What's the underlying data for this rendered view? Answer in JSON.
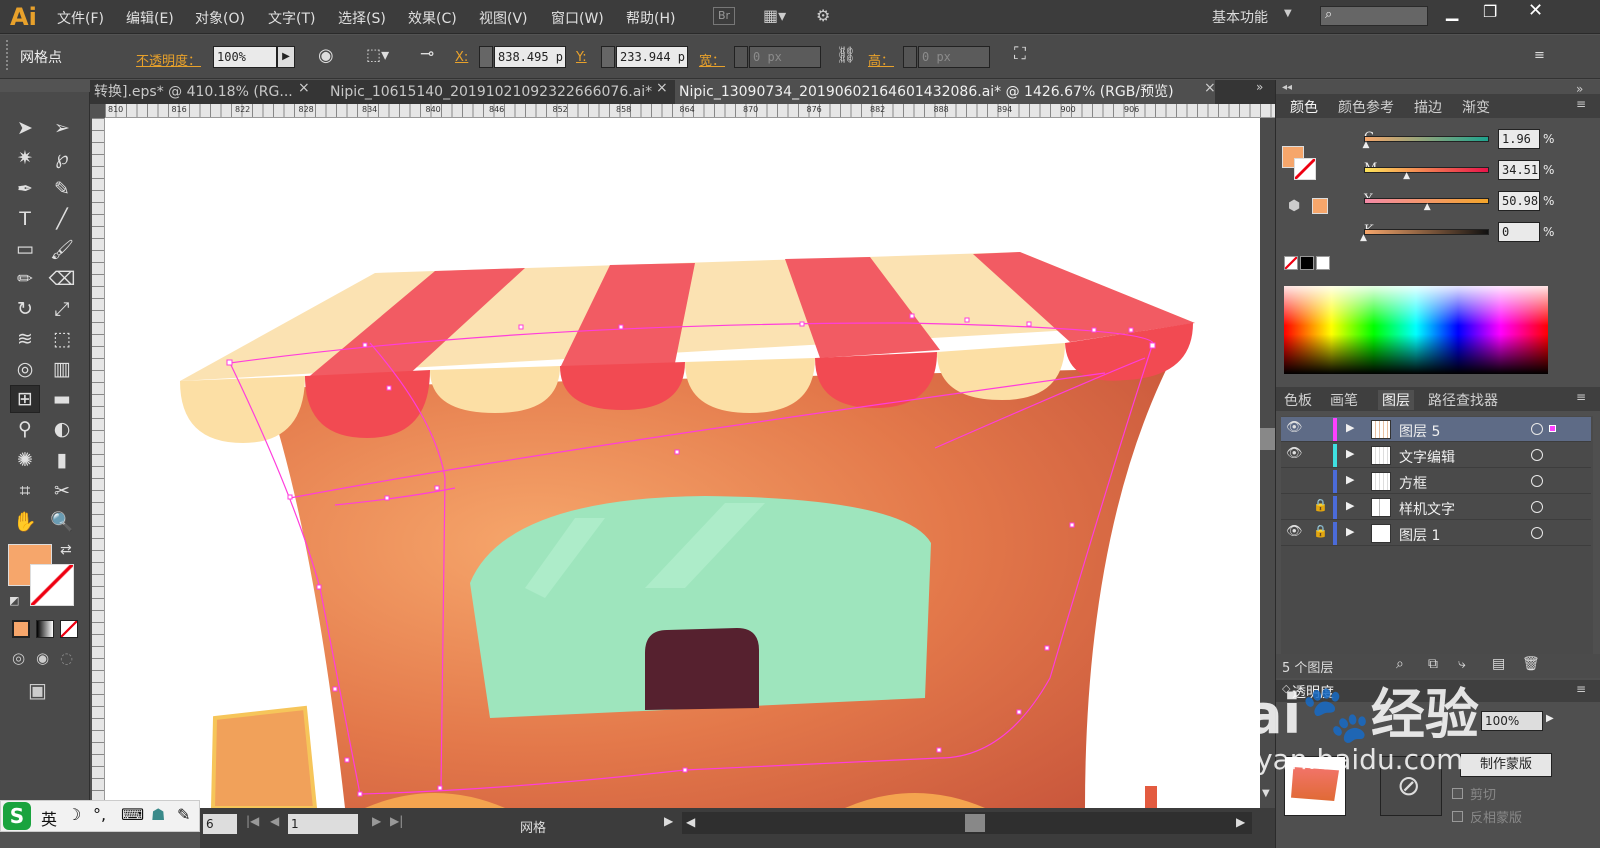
{
  "app": {
    "logo": "Ai"
  },
  "menu": [
    "文件(F)",
    "编辑(E)",
    "对象(O)",
    "文字(T)",
    "选择(S)",
    "效果(C)",
    "视图(V)",
    "窗口(W)",
    "帮助(H)"
  ],
  "menubar": {
    "br": "Br",
    "workspace": "基本功能",
    "search_placeholder": ""
  },
  "control": {
    "tool_name": "网格点",
    "opacity_label": "不透明度：",
    "opacity_value": "100%",
    "x_label": "X:",
    "x_value": "838.495 p",
    "y_label": "Y:",
    "y_value": "233.944 p",
    "w_label": "宽：",
    "w_value": "0 px",
    "h_label": "高：",
    "h_value": "0 px"
  },
  "tabs": [
    {
      "label": "转换].eps* @ 410.18% (RG...",
      "active": false
    },
    {
      "label": "Nipic_10615140_20191021092322666076.ai*",
      "active": false
    },
    {
      "label": "Nipic_13090734_20190602164601432086.ai* @ 1426.67% (RGB/预览)",
      "active": true
    }
  ],
  "ruler": {
    "top_ticks": [
      "810",
      "816",
      "822",
      "828",
      "834",
      "840",
      "846",
      "852",
      "858",
      "864",
      "870",
      "876",
      "882",
      "888",
      "894",
      "900",
      "906"
    ]
  },
  "color_panel": {
    "tabs": [
      "颜色",
      "颜色参考",
      "描边",
      "渐变"
    ],
    "channels": [
      {
        "name": "C",
        "value": "1.96",
        "unit": "%",
        "pos": 0.02
      },
      {
        "name": "M",
        "value": "34.51",
        "unit": "%",
        "pos": 0.345
      },
      {
        "name": "Y",
        "value": "50.98",
        "unit": "%",
        "pos": 0.51
      },
      {
        "name": "K",
        "value": "0",
        "unit": "%",
        "pos": 0
      }
    ],
    "fill_color": "#f6a66b"
  },
  "layers_panel": {
    "tabs": [
      "色板",
      "画笔",
      "图层",
      "路径查找器"
    ],
    "layers": [
      {
        "name": "图层 5",
        "color": "#ff40ff",
        "visible": true,
        "locked": false,
        "selected": true
      },
      {
        "name": "文字编辑",
        "color": "#3fe0e0",
        "visible": true,
        "locked": false,
        "selected": false
      },
      {
        "name": "方框",
        "color": "#4b6bd8",
        "visible": false,
        "locked": false,
        "selected": false
      },
      {
        "name": "样机文字",
        "color": "#4b6bd8",
        "visible": false,
        "locked": true,
        "selected": false
      },
      {
        "name": "图层 1",
        "color": "#4b6bd8",
        "visible": true,
        "locked": true,
        "selected": false
      }
    ],
    "count": "5 个图层"
  },
  "transparency_panel": {
    "title": "透明度",
    "opacity": "100%",
    "make_mask": "制作蒙版",
    "clip": "剪切",
    "invert": "反相蒙版"
  },
  "status": {
    "zoom": "6",
    "page": "1",
    "mode": "网格"
  },
  "ime": {
    "lang": "英"
  },
  "watermark": {
    "brand": "Bai",
    "brand2": "经验",
    "url": "jingyan.baidu.com"
  }
}
